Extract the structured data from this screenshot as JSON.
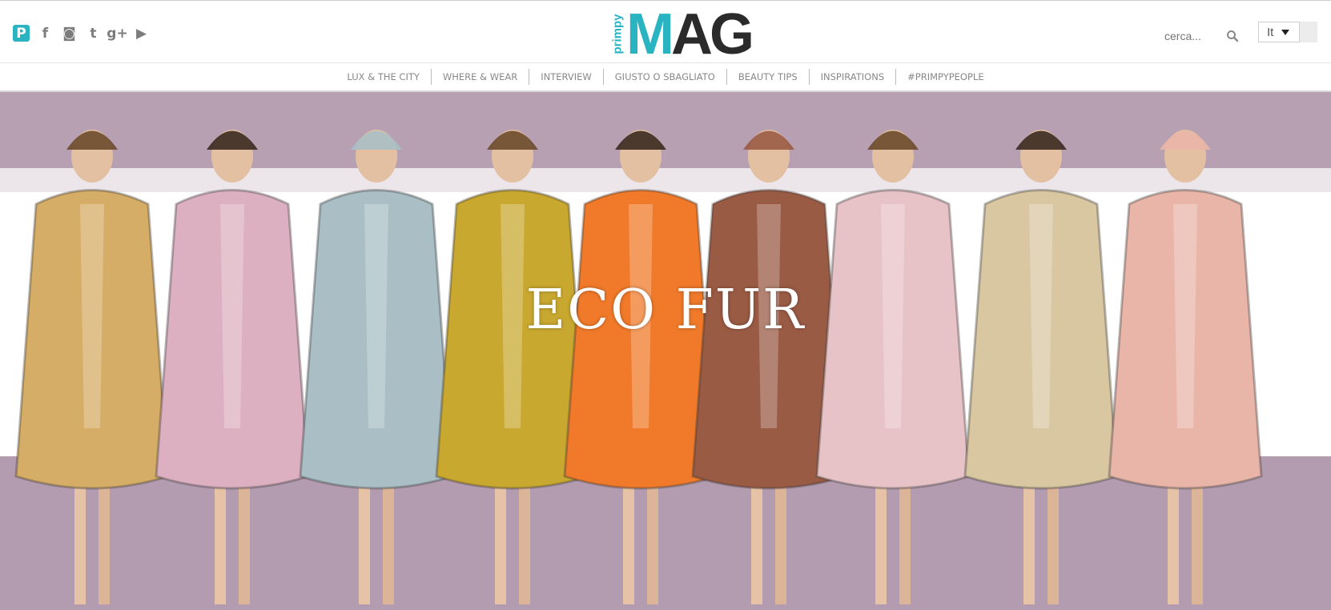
{
  "header": {
    "social": [
      {
        "name": "primpy-icon",
        "glyph": "P"
      },
      {
        "name": "facebook-icon",
        "glyph": "f"
      },
      {
        "name": "instagram-icon",
        "glyph": "◙"
      },
      {
        "name": "twitter-icon",
        "glyph": "t"
      },
      {
        "name": "google-plus-icon",
        "glyph": "g+"
      },
      {
        "name": "youtube-icon",
        "glyph": "▶"
      }
    ],
    "logo": {
      "side": "primpy",
      "big1": "M",
      "big2": "AG"
    },
    "search": {
      "placeholder": "cerca..."
    },
    "language": {
      "selected": "It"
    }
  },
  "nav": {
    "items": [
      "LUX & THE CITY",
      "WHERE & WEAR",
      "INTERVIEW",
      "GIUSTO O SBAGLIATO",
      "BEAUTY TIPS",
      "INSPIRATIONS",
      "#PRIMPYPEOPLE"
    ]
  },
  "hero": {
    "title": "ECO FUR",
    "background": "#b7a0b2",
    "band": "#ffffff",
    "coats": [
      "#d6ad66",
      "#dcb0c0",
      "#a9bfc5",
      "#c9a830",
      "#f07a2a",
      "#9a5b44",
      "#e7c2c6",
      "#d9c7a2",
      "#e9b5a8"
    ]
  },
  "colors": {
    "accent": "#2ab3c0",
    "text": "#888888"
  }
}
